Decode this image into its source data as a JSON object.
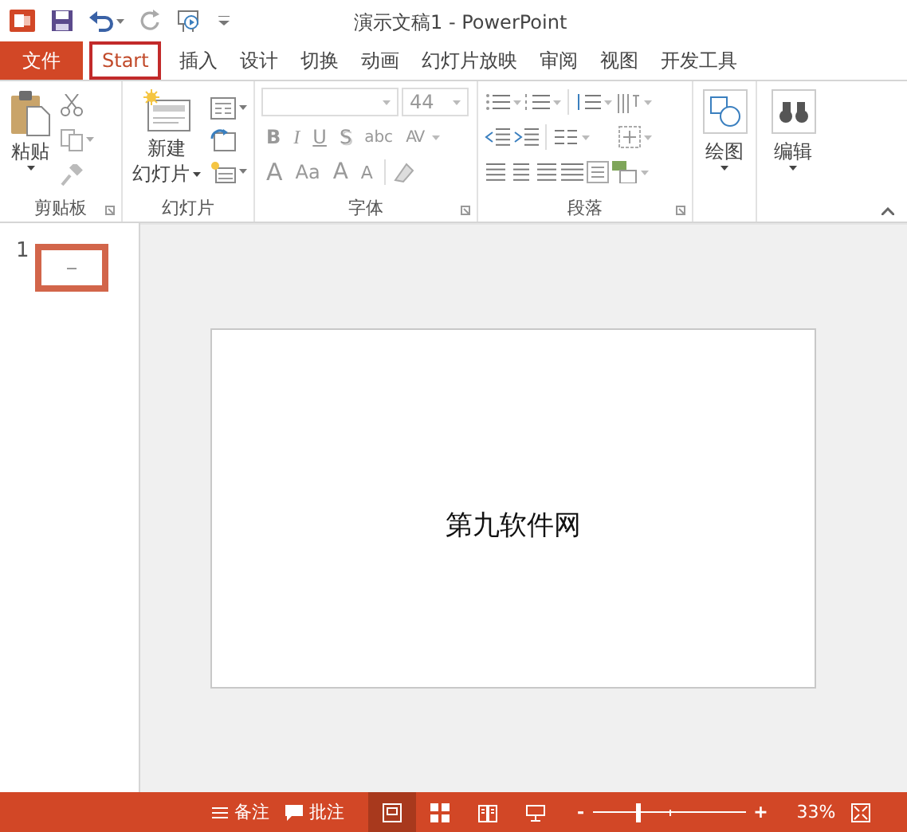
{
  "window": {
    "title": "演示文稿1 - PowerPoint"
  },
  "tabs": [
    {
      "label": "文件",
      "kind": "file",
      "selected": false
    },
    {
      "label": "Start",
      "kind": "tab",
      "selected": true
    },
    {
      "label": "插入",
      "kind": "tab",
      "selected": false
    },
    {
      "label": "设计",
      "kind": "tab",
      "selected": false
    },
    {
      "label": "切换",
      "kind": "tab",
      "selected": false
    },
    {
      "label": "动画",
      "kind": "tab",
      "selected": false
    },
    {
      "label": "幻灯片放映",
      "kind": "tab",
      "selected": false
    },
    {
      "label": "审阅",
      "kind": "tab",
      "selected": false
    },
    {
      "label": "视图",
      "kind": "tab",
      "selected": false
    },
    {
      "label": "开发工具",
      "kind": "tab",
      "selected": false
    }
  ],
  "ribbon": {
    "clipboard": {
      "label": "剪贴板",
      "paste": "粘贴"
    },
    "slides": {
      "label": "幻灯片",
      "new_slide_lines": [
        "新建",
        "幻灯片"
      ]
    },
    "font": {
      "label": "字体",
      "font_size": "44",
      "row_2": [
        "B",
        "I",
        "U",
        "S",
        "abc",
        "AV"
      ],
      "row_3": [
        "A",
        "Aa",
        "A",
        "A"
      ]
    },
    "paragraph": {
      "label": "段落"
    },
    "drawing": {
      "button": "绘图"
    },
    "editing": {
      "button": "编辑"
    }
  },
  "slide_thumbnails": [
    {
      "number": "1",
      "selected": true
    }
  ],
  "slide": {
    "text": "第九软件网"
  },
  "status_bar": {
    "notes": "备注",
    "comments": "批注",
    "views": [
      {
        "kind": "normal",
        "selected": true
      },
      {
        "kind": "sorter",
        "selected": false
      },
      {
        "kind": "reading",
        "selected": false
      },
      {
        "kind": "slideshow",
        "selected": false
      }
    ],
    "zoom": {
      "minus": "-",
      "plus": "+",
      "level": 0.3,
      "value": "33%"
    }
  }
}
